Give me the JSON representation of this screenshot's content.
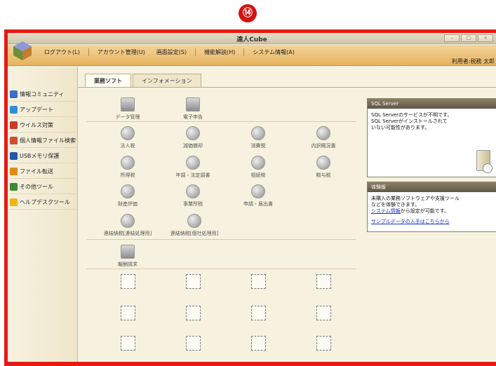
{
  "step_number": "⑭",
  "window": {
    "title": "達人Cube",
    "controls": [
      "–",
      "□",
      "×"
    ]
  },
  "menu": {
    "items": [
      "ログアウト(L)",
      "アカウント管理(U)",
      "画面設定(S)",
      "機能解説(H)",
      "システム情報(A)"
    ],
    "user_label": "利用者:税務 太郎"
  },
  "sidebar": {
    "items": [
      {
        "label": "情報コミュニティ",
        "icon": "community-icon",
        "color": "#3a6fc8"
      },
      {
        "label": "アップデート",
        "icon": "update-icon",
        "color": "#2e8ed8"
      },
      {
        "label": "ウイルス対策",
        "icon": "antivirus-icon",
        "color": "#cf3a2a"
      },
      {
        "label": "個人情報ファイル検索",
        "icon": "file-search-icon",
        "color": "#d24a30"
      },
      {
        "label": "USBメモリ保護",
        "icon": "usb-icon",
        "color": "#2358a8"
      },
      {
        "label": "ファイル転送",
        "icon": "transfer-icon",
        "color": "#e08a18"
      },
      {
        "label": "その他ツール",
        "icon": "tools-icon",
        "color": "#3b8c35"
      },
      {
        "label": "ヘルプデスクツール",
        "icon": "helpdesk-icon",
        "color": "#f2b318"
      }
    ]
  },
  "tabs": [
    {
      "label": "業務ソフト",
      "active": true
    },
    {
      "label": "インフォメーション",
      "active": false
    }
  ],
  "apps": {
    "data_manager": "データ管理",
    "e_filing": "電子申告",
    "corporate_tax": "法人税",
    "depreciation": "減価償却",
    "consumption_tax": "消費税",
    "breakdown": "内訳概況書",
    "income_tax": "所得税",
    "year_end": "年調・法定調書",
    "inheritance_tax": "相続税",
    "gift_tax": "贈与税",
    "property_valuation": "財産評価",
    "business_office_tax": "事業所税",
    "applications": "申請・届出書",
    "consolidated_group": "連結納税[連結処理用]",
    "consolidated_individual": "連結納税[個社処理用]",
    "billing": "報酬請求"
  },
  "sql_panel": {
    "title": "SQL Server",
    "lines": [
      "SQL Serverのサービスが不明です。",
      "SQL Serverがインストールされて",
      "いない可能性があります。"
    ]
  },
  "trial_panel": {
    "title": "体験版",
    "lines": [
      "未購入の業務ソフトウェアや支援ツール",
      "などを体験できます。"
    ],
    "system_link": "システム情報",
    "system_suffix": "から設定が可能です。",
    "sample_link": "サンプルデータの入手はこちらから"
  },
  "colors": {
    "frame": "#e31b14",
    "menubar": "#ebbd6a",
    "window_bg": "#f7f1df",
    "panel_header": "#6f6652",
    "link": "#1a37c9"
  }
}
